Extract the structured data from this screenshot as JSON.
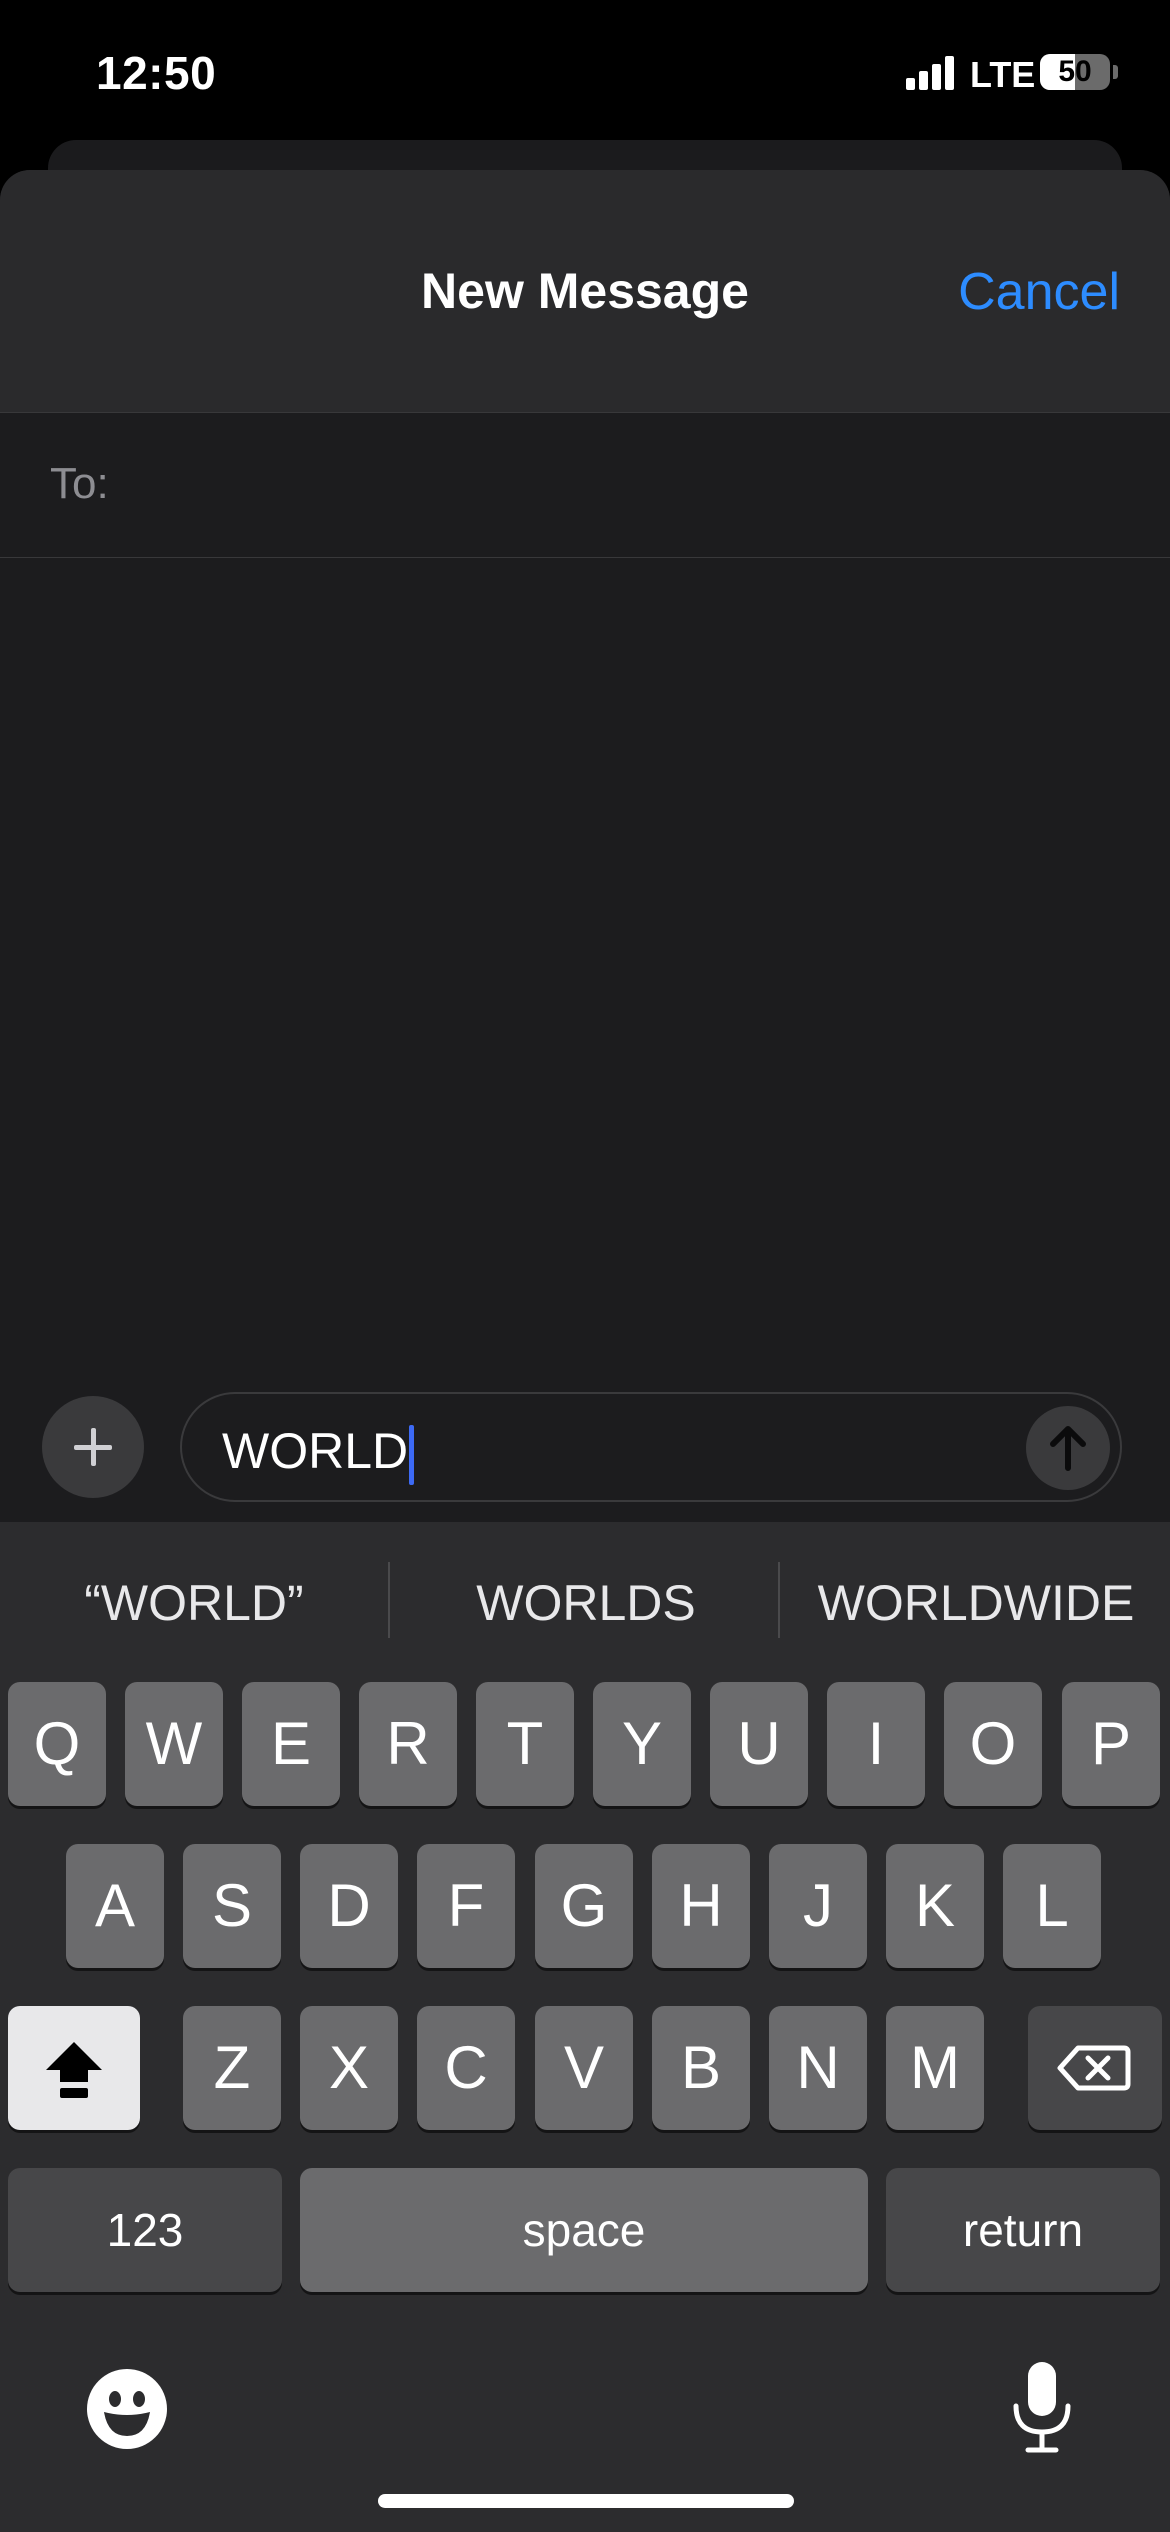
{
  "status_bar": {
    "time": "12:50",
    "network": "LTE",
    "battery": "50",
    "battery_level": 0.5
  },
  "nav": {
    "title": "New Message",
    "cancel_label": "Cancel"
  },
  "to_field": {
    "label": "To:",
    "value": ""
  },
  "message": {
    "text": "WORLD"
  },
  "suggestions": [
    "“WORLD”",
    "WORLDS",
    "WORLDWIDE"
  ],
  "keyboard": {
    "row1": [
      "Q",
      "W",
      "E",
      "R",
      "T",
      "Y",
      "U",
      "I",
      "O",
      "P"
    ],
    "row2": [
      "A",
      "S",
      "D",
      "F",
      "G",
      "H",
      "J",
      "K",
      "L"
    ],
    "row3": [
      "Z",
      "X",
      "C",
      "V",
      "B",
      "N",
      "M"
    ],
    "numbers_label": "123",
    "space_label": "space",
    "return_label": "return"
  },
  "colors": {
    "accent": "#2d8cff",
    "caret": "#3d6af5",
    "key": "#6b6b6d",
    "keyboard_bg": "#2c2c2e"
  },
  "icons": [
    "signal-icon",
    "battery-icon",
    "plus-icon",
    "send-arrow-icon",
    "shift-icon",
    "delete-icon",
    "emoji-icon",
    "microphone-icon"
  ]
}
